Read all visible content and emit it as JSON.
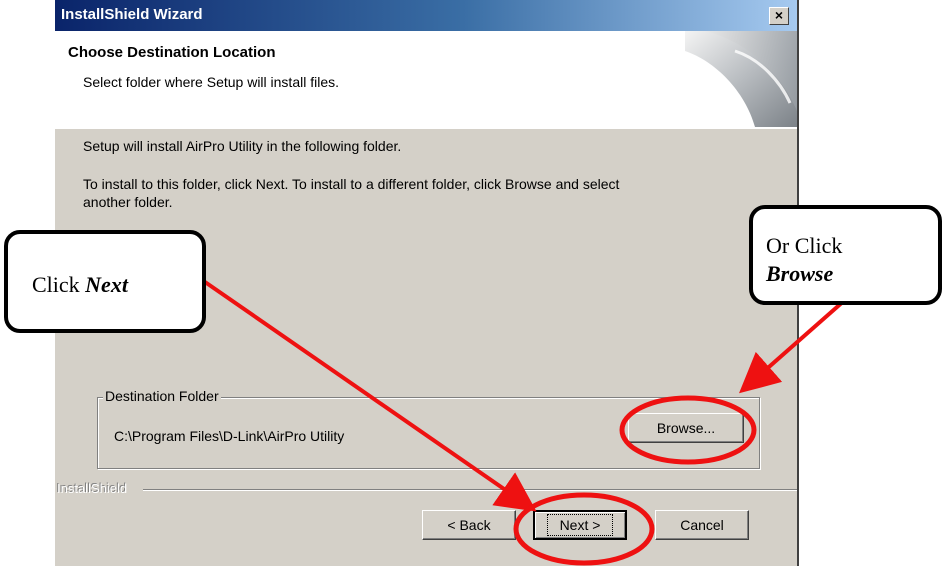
{
  "window": {
    "title": "InstallShield Wizard",
    "close_label": "×"
  },
  "header": {
    "title": "Choose Destination Location",
    "subtitle": "Select folder where Setup will install files."
  },
  "body": {
    "line1": "Setup will install AirPro Utility in the following folder.",
    "line2a": "To install to this folder, click Next. To install to a different folder, click Browse and select",
    "line2b": "another folder."
  },
  "destination": {
    "group_label": "Destination Folder",
    "path": "C:\\Program Files\\D-Link\\AirPro Utility",
    "browse_label": "Browse..."
  },
  "footer": {
    "brand": "InstallShield",
    "back_label": "< Back",
    "next_label": "Next >",
    "cancel_label": "Cancel"
  },
  "callouts": {
    "next_prefix": "Click",
    "next_emph": "Next",
    "browse_prefix": "Or Click",
    "browse_emph": "Browse"
  },
  "colors": {
    "annotation": "#ee1111",
    "titlebar_start": "#0a246a",
    "dialog_bg": "#d4d0c8"
  }
}
